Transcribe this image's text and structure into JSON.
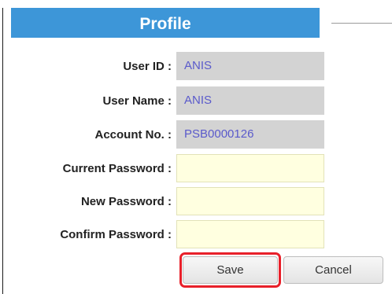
{
  "panel": {
    "title": "Profile"
  },
  "fields": [
    {
      "label": "User ID :",
      "value": "ANIS",
      "editable": false
    },
    {
      "label": "User Name :",
      "value": "ANIS",
      "editable": false
    },
    {
      "label": "Account No. :",
      "value": "PSB0000126",
      "editable": false
    },
    {
      "label": "Current Password :",
      "value": "",
      "editable": true
    },
    {
      "label": "New Password :",
      "value": "",
      "editable": true
    },
    {
      "label": "Confirm Password :",
      "value": "",
      "editable": true
    }
  ],
  "buttons": {
    "save_label": "Save",
    "cancel_label": "Cancel"
  },
  "colors": {
    "header_bg": "#3d96d8",
    "readonly_bg": "#d3d3d3",
    "readonly_text": "#5a5acb",
    "editable_bg": "#ffffe0",
    "highlight": "#e8202a"
  }
}
